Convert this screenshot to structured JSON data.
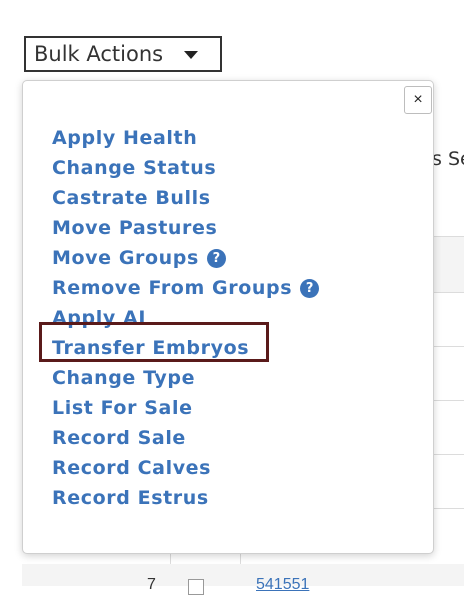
{
  "bulk_actions": {
    "label": "Bulk Actions"
  },
  "dropdown": {
    "close_label": "×",
    "items": [
      {
        "label": "Apply Health",
        "help": false
      },
      {
        "label": "Change Status",
        "help": false
      },
      {
        "label": "Castrate Bulls",
        "help": false
      },
      {
        "label": "Move Pastures",
        "help": false
      },
      {
        "label": "Move Groups",
        "help": true
      },
      {
        "label": "Remove From Groups",
        "help": true
      },
      {
        "label": "Apply AI",
        "help": false
      },
      {
        "label": "Transfer Embryos",
        "help": false,
        "highlighted": true
      },
      {
        "label": "Change Type",
        "help": false
      },
      {
        "label": "List For Sale",
        "help": false
      },
      {
        "label": "Record Sale",
        "help": false
      },
      {
        "label": "Record Calves",
        "help": false
      },
      {
        "label": "Record Estrus",
        "help": false
      }
    ],
    "help_icon_glyph": "?"
  },
  "background_table": {
    "header_fragment": "s Se",
    "row_number": "7",
    "row_link": "541551"
  },
  "colors": {
    "link_blue": "#3b73b9",
    "highlight_border": "#5a1a1a"
  }
}
